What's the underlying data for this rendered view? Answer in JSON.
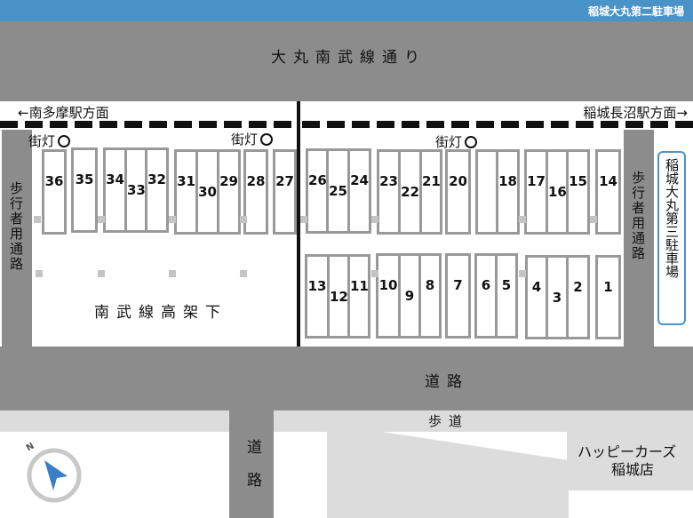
{
  "header": {
    "title": "稲城大丸第二駐車場",
    "bar_color": "#4a93c8"
  },
  "roads": {
    "top_avenue": "大丸南武線通り",
    "direction_left": "←南多摩駅方面",
    "direction_right": "稲城長沼駅方面→",
    "bottom_road": "道路",
    "sidewalk": "歩道",
    "side_road": "道路",
    "walkway_left": "歩行者用通路",
    "walkway_right": "歩行者用通路"
  },
  "areas": {
    "under_viaduct": "南武線高架下"
  },
  "street_lamp_label": "街灯",
  "neighbor_lot": "稲城大丸第三駐車場",
  "shop": {
    "line1": "ハッピーカーズ",
    "line2": "稲城店"
  },
  "compass_letter": "N",
  "stalls": {
    "s36": "36",
    "s35": "35",
    "s34": "34",
    "s33": "33",
    "s32": "32",
    "s31": "31",
    "s30": "30",
    "s29": "29",
    "s28": "28",
    "s27": "27",
    "s26": "26",
    "s25": "25",
    "s24": "24",
    "s23": "23",
    "s22": "22",
    "s21": "21",
    "s20": "20",
    "s18": "18",
    "s17": "17",
    "s16": "16",
    "s15": "15",
    "s14": "14",
    "s13": "13",
    "s12": "12",
    "s11": "11",
    "s10": "10",
    "s9": "9",
    "s8": "8",
    "s7": "7",
    "s6": "6",
    "s5": "5",
    "s4": "4",
    "s3": "3",
    "s2": "2",
    "s1": "1"
  }
}
